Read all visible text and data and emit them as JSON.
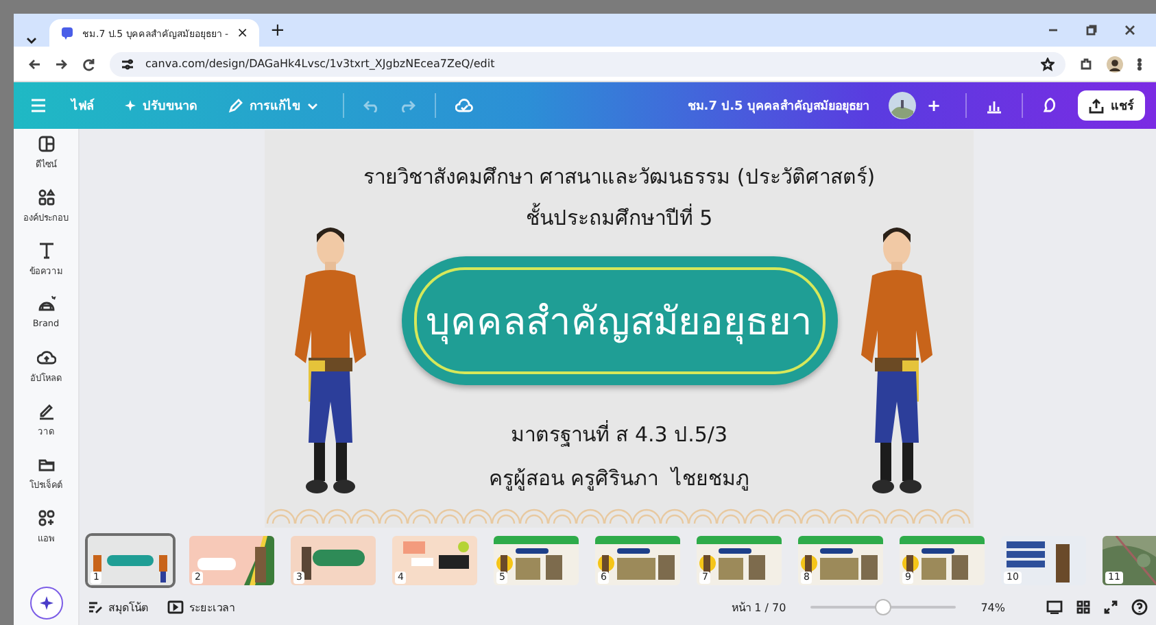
{
  "browser": {
    "tab_title": "ชม.7 ป.5 บุคคลสำคัญสมัยอยุธยา -",
    "tab_close": "×",
    "new_tab": "+",
    "url": "canva.com/design/DAGaHk4Lvsc/1v3txrt_XJgbzNEcea7ZeQ/edit"
  },
  "toolbar": {
    "menus": [
      {
        "label": "ไฟล์",
        "kind": "text"
      },
      {
        "label": "ปรับขนาด",
        "kind": "star"
      },
      {
        "label": "การแก้ไข",
        "kind": "pencil"
      }
    ],
    "doc_title": "ชม.7 ป.5 บุคคลสำคัญสมัยอยุธยา",
    "add": "+",
    "share": "แชร์"
  },
  "sidebar": {
    "items": [
      {
        "label": "ดีไซน์",
        "kind": "design"
      },
      {
        "label": "องค์ประกอบ",
        "kind": "elements"
      },
      {
        "label": "ข้อความ",
        "kind": "text"
      },
      {
        "label": "Brand",
        "kind": "brand"
      },
      {
        "label": "อัปโหลด",
        "kind": "upload"
      },
      {
        "label": "วาด",
        "kind": "draw"
      },
      {
        "label": "โปรเจ็คต์",
        "kind": "projects"
      },
      {
        "label": "แอพ",
        "kind": "apps"
      }
    ]
  },
  "slide": {
    "subject": "รายวิชาสังคมศึกษา ศาสนาและวัฒนธรรม (ประวัติศาสตร์)",
    "grade": "ชั้นประถมศึกษาปีที่ 5",
    "title": "บุคคลสำคัญสมัยอยุธยา",
    "standard": "มาตรฐานที่ ส 4.3 ป.5/3",
    "teacher": "ครูผู้สอน ครูศิรินภา  ไชยชมภู"
  },
  "thumbnails": [
    {
      "number": "1",
      "selected": true
    },
    {
      "number": "2",
      "selected": false
    },
    {
      "number": "3",
      "selected": false
    },
    {
      "number": "4",
      "selected": false
    },
    {
      "number": "5",
      "selected": false
    },
    {
      "number": "6",
      "selected": false
    },
    {
      "number": "7",
      "selected": false
    },
    {
      "number": "8",
      "selected": false
    },
    {
      "number": "9",
      "selected": false
    },
    {
      "number": "10",
      "selected": false
    },
    {
      "number": "11",
      "selected": false
    }
  ],
  "footer": {
    "notes": "สมุดโน้ต",
    "duration": "ระยะเวลา",
    "page": "หน้า 1 / 70",
    "zoom": {
      "level": 0.5
    },
    "zoom_reading": "74%"
  }
}
